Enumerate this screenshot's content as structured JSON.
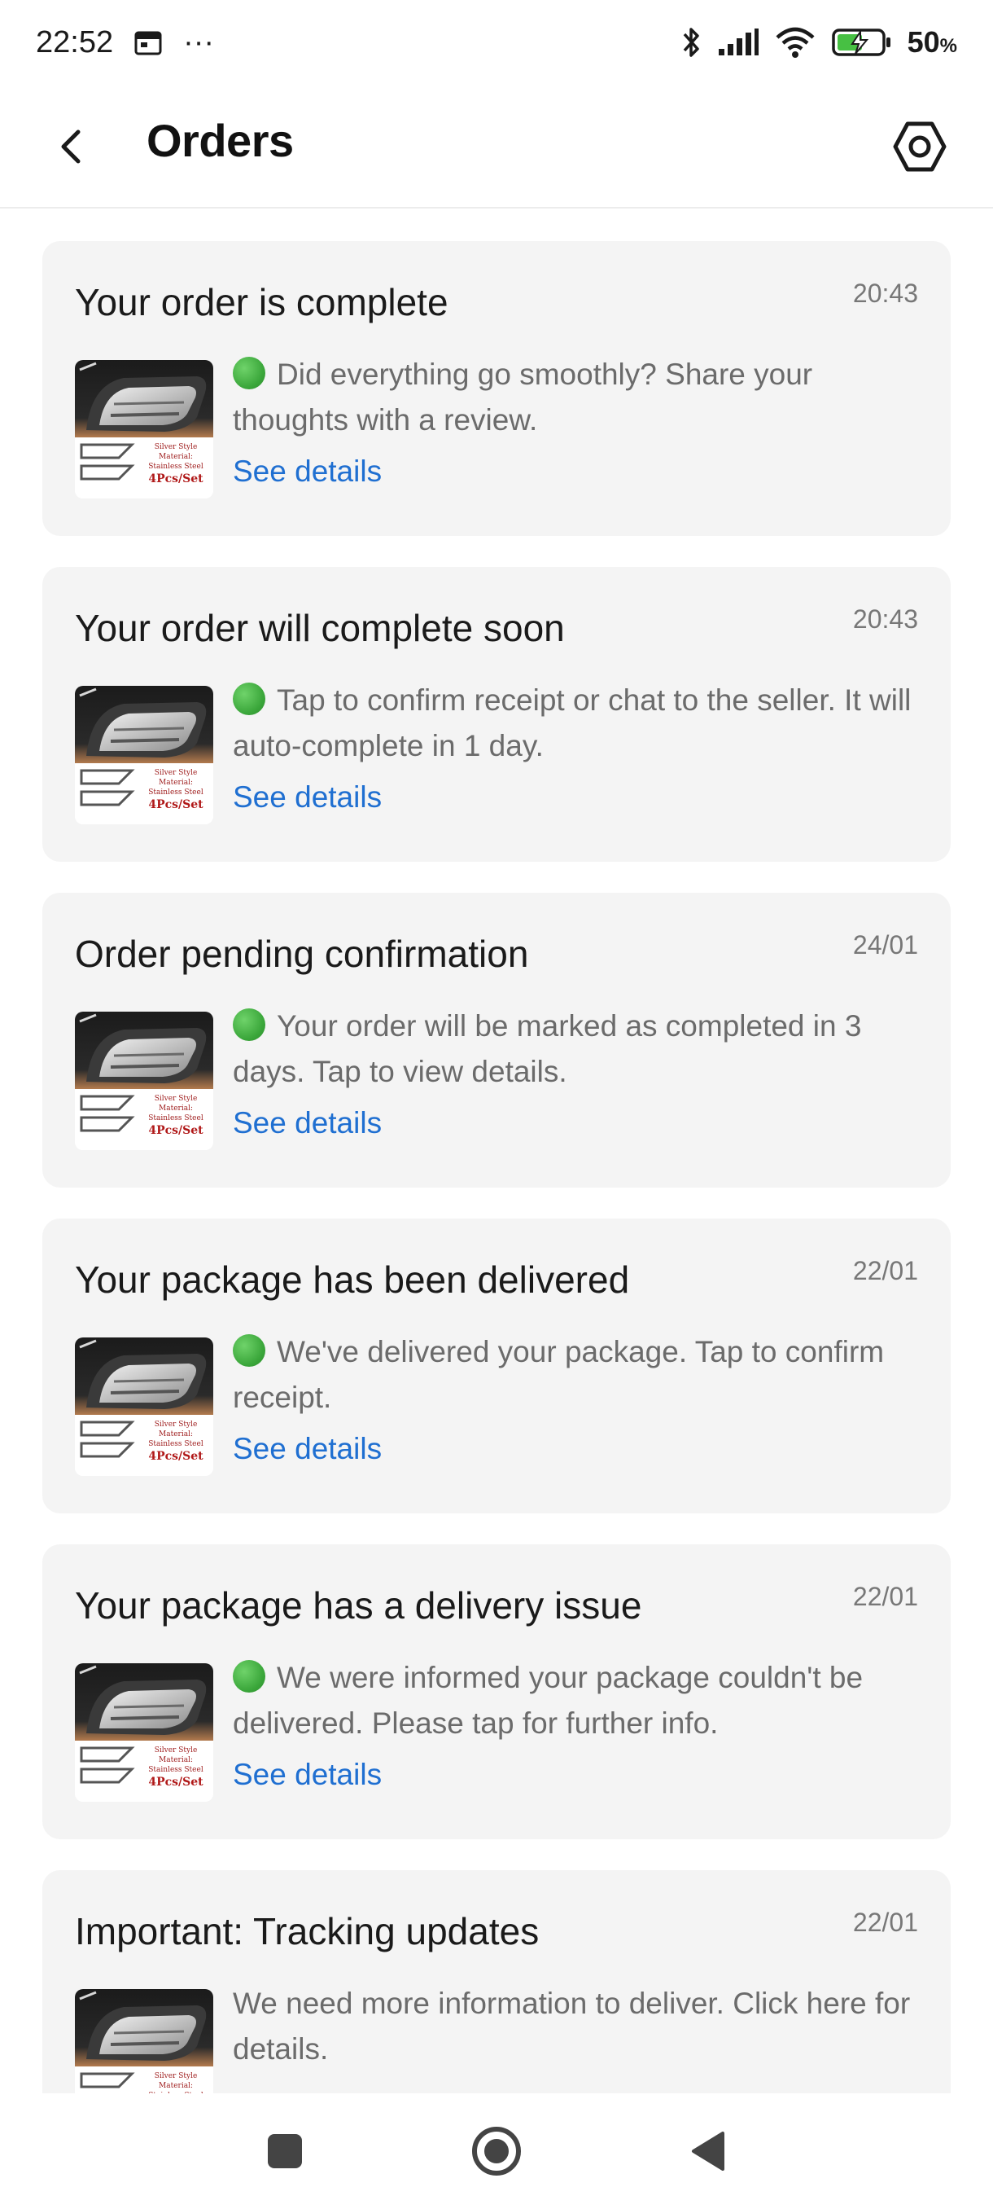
{
  "status_bar": {
    "time": "22:52",
    "more": "···",
    "battery": "50",
    "battery_unit": "%",
    "icons": [
      "calendar-icon",
      "bluetooth-icon",
      "signal-icon",
      "wifi-icon",
      "battery-charging-icon"
    ]
  },
  "header": {
    "title": "Orders",
    "back_icon": "back-arrow-icon",
    "settings_icon": "settings-icon"
  },
  "orders": [
    {
      "title": "Your order is complete",
      "time": "20:43",
      "has_dot": true,
      "message": "Did everything go smoothly? Share your thoughts with a review.",
      "link": "See details"
    },
    {
      "title": "Your order will complete soon",
      "time": "20:43",
      "has_dot": true,
      "message": "Tap to confirm receipt or chat to the seller. It will auto-complete in 1 day.",
      "link": "See details"
    },
    {
      "title": "Order pending confirmation",
      "time": "24/01",
      "has_dot": true,
      "message": "Your order will be marked as completed in 3 days. Tap to view details.",
      "link": "See details"
    },
    {
      "title": "Your package has been delivered",
      "time": "22/01",
      "has_dot": true,
      "message": "We've delivered your package. Tap to confirm receipt.",
      "link": "See details"
    },
    {
      "title": "Your package has a delivery issue",
      "time": "22/01",
      "has_dot": true,
      "message": "We were informed your package couldn't be delivered. Please tap for further info.",
      "link": "See details"
    },
    {
      "title": "Important: Tracking updates",
      "time": "22/01",
      "has_dot": false,
      "message": "We need more information to deliver. Click here for details.",
      "link": ""
    }
  ],
  "product_thumb": {
    "line1": "Silver Style",
    "line2": "Material:",
    "line3": "Stainless Steel",
    "line4": "4Pcs/Set"
  },
  "nav_bar": {
    "icons": [
      "recent-apps-icon",
      "home-icon",
      "back-icon"
    ]
  },
  "colors": {
    "link": "#1f6fd1",
    "card_bg": "#f4f4f4",
    "status_dot": "#3aa63a"
  }
}
